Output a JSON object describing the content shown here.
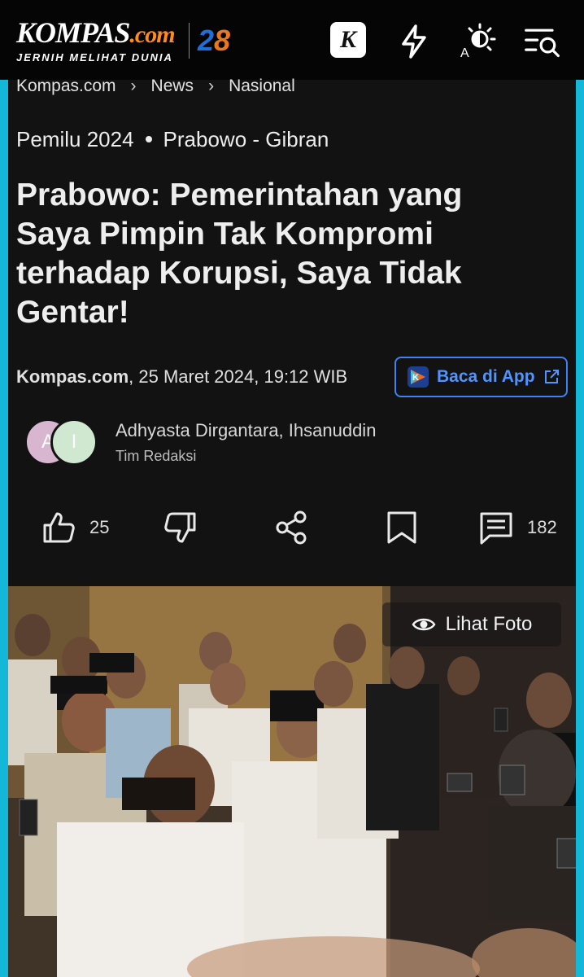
{
  "header": {
    "logo_main": "KOMPAS",
    "logo_dotcom": ".com",
    "logo_tagline": "JERNIH MELIHAT DUNIA",
    "anniversary_digit_1": "2",
    "anniversary_digit_2": "8",
    "app_badge_letter": "K",
    "icons": [
      "kompas-app-icon",
      "lightning-icon",
      "brightness-icon",
      "menu-search-icon"
    ]
  },
  "breadcrumb": [
    "Kompas.com",
    "News",
    "Nasional"
  ],
  "tags": [
    "Pemilu 2024",
    "Prabowo - Gibran"
  ],
  "article": {
    "headline": "Prabowo: Pemerintahan yang Saya Pimpin Tak Kompromi terhadap Korupsi, Saya Tidak Gentar!",
    "source": "Kompas.com",
    "datetime": ", 25 Maret 2024, 19:12 WIB",
    "app_button_label": "Baca di App"
  },
  "authors": {
    "initial_1": "A",
    "initial_2": "I",
    "names": "Adhyasta Dirgantara, Ihsanuddin",
    "team": "Tim Redaksi"
  },
  "actions": {
    "like_count": "25",
    "comment_count": "182"
  },
  "photo": {
    "view_label": "Lihat Foto"
  },
  "colors": {
    "accent_cyan": "#13b8d8",
    "link_blue": "#4f94ff",
    "logo_orange": "#ff8a1f"
  }
}
